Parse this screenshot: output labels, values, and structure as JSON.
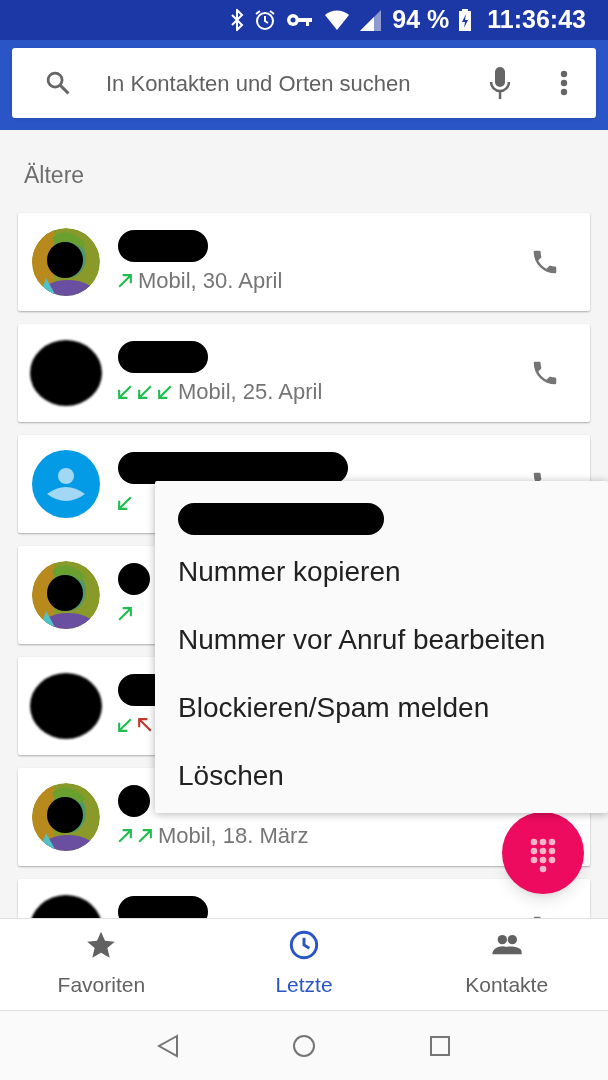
{
  "status_bar": {
    "battery": "94 %",
    "time": "11:36:43"
  },
  "search": {
    "placeholder": "In Kontakten und Orten suchen"
  },
  "section_title": "Ältere",
  "calls": [
    {
      "arrows": [
        {
          "kind": "outgoing"
        }
      ],
      "detail": "Mobil, 30. April"
    },
    {
      "kind": "redacted",
      "arrows": [
        {
          "kind": "incoming"
        },
        {
          "kind": "incoming"
        },
        {
          "kind": "incoming"
        }
      ],
      "detail": "Mobil, 25. April"
    },
    {
      "kind": "default",
      "arrows": [
        {
          "kind": "incoming"
        }
      ]
    },
    {
      "arrows": [
        {
          "kind": "outgoing"
        }
      ]
    },
    {
      "kind": "redacted",
      "arrows": [
        {
          "kind": "incoming"
        },
        {
          "kind": "missed"
        }
      ]
    },
    {
      "arrows": [
        {
          "kind": "outgoing"
        },
        {
          "kind": "outgoing"
        }
      ],
      "detail": "Mobil, 18. März"
    },
    {
      "kind": "redacted"
    }
  ],
  "context_menu": {
    "items": [
      "Nummer kopieren",
      "Nummer vor Anruf bearbeiten",
      "Blockieren/Spam melden",
      "Löschen"
    ]
  },
  "bottom_tabs": [
    {
      "label": "Favoriten",
      "selected": false
    },
    {
      "label": "Letzte",
      "selected": true
    },
    {
      "label": "Kontakte",
      "selected": false
    }
  ]
}
